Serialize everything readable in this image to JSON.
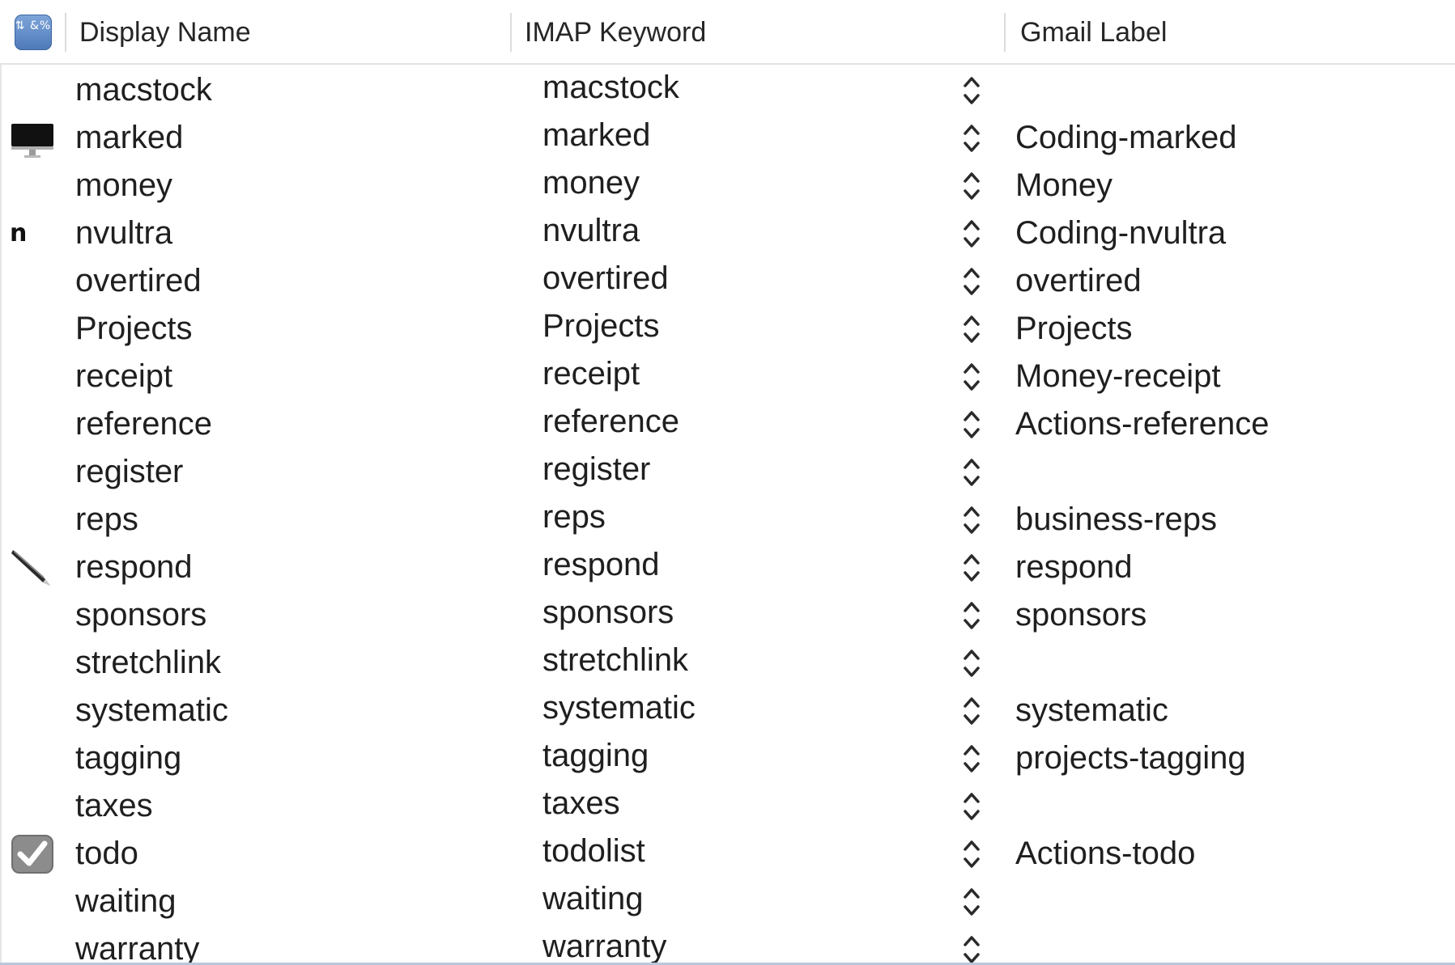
{
  "header": {
    "icon_column_glyph": "⇅ &%",
    "columns": [
      "Display Name",
      "IMAP Keyword",
      "Gmail Label"
    ]
  },
  "rows": [
    {
      "name": "macstock",
      "keyword": "macstock",
      "label": "",
      "icon": ""
    },
    {
      "name": "marked",
      "keyword": "marked",
      "label": "Coding-marked",
      "icon": "monitor-icon"
    },
    {
      "name": "money",
      "keyword": "money",
      "label": "Money",
      "icon": ""
    },
    {
      "name": "nvultra",
      "keyword": "nvultra",
      "label": "Coding-nvultra",
      "icon": "n-letter-icon",
      "icon_text": "n"
    },
    {
      "name": "overtired",
      "keyword": "overtired",
      "label": "overtired",
      "icon": ""
    },
    {
      "name": "Projects",
      "keyword": "Projects",
      "label": "Projects",
      "icon": ""
    },
    {
      "name": "receipt",
      "keyword": "receipt",
      "label": "Money-receipt",
      "icon": ""
    },
    {
      "name": "reference",
      "keyword": "reference",
      "label": "Actions-reference",
      "icon": ""
    },
    {
      "name": "register",
      "keyword": "register",
      "label": "",
      "icon": ""
    },
    {
      "name": "reps",
      "keyword": "reps",
      "label": "business-reps",
      "icon": ""
    },
    {
      "name": "respond",
      "keyword": "respond",
      "label": "respond",
      "icon": "pen-icon"
    },
    {
      "name": "sponsors",
      "keyword": "sponsors",
      "label": "sponsors",
      "icon": ""
    },
    {
      "name": "stretchlink",
      "keyword": "stretchlink",
      "label": "",
      "icon": ""
    },
    {
      "name": "systematic",
      "keyword": "systematic",
      "label": "systematic",
      "icon": ""
    },
    {
      "name": "tagging",
      "keyword": "tagging",
      "label": "projects-tagging",
      "icon": ""
    },
    {
      "name": "taxes",
      "keyword": "taxes",
      "label": "",
      "icon": ""
    },
    {
      "name": "todo",
      "keyword": "todolist",
      "label": "Actions-todo",
      "icon": "checkbox-icon"
    },
    {
      "name": "waiting",
      "keyword": "waiting",
      "label": "",
      "icon": ""
    },
    {
      "name": "warranty",
      "keyword": "warranty",
      "label": "",
      "icon": ""
    }
  ],
  "colors": {
    "accent": "#4d79b8",
    "text": "#1f1f1f",
    "header_border": "#e3e3e3"
  }
}
